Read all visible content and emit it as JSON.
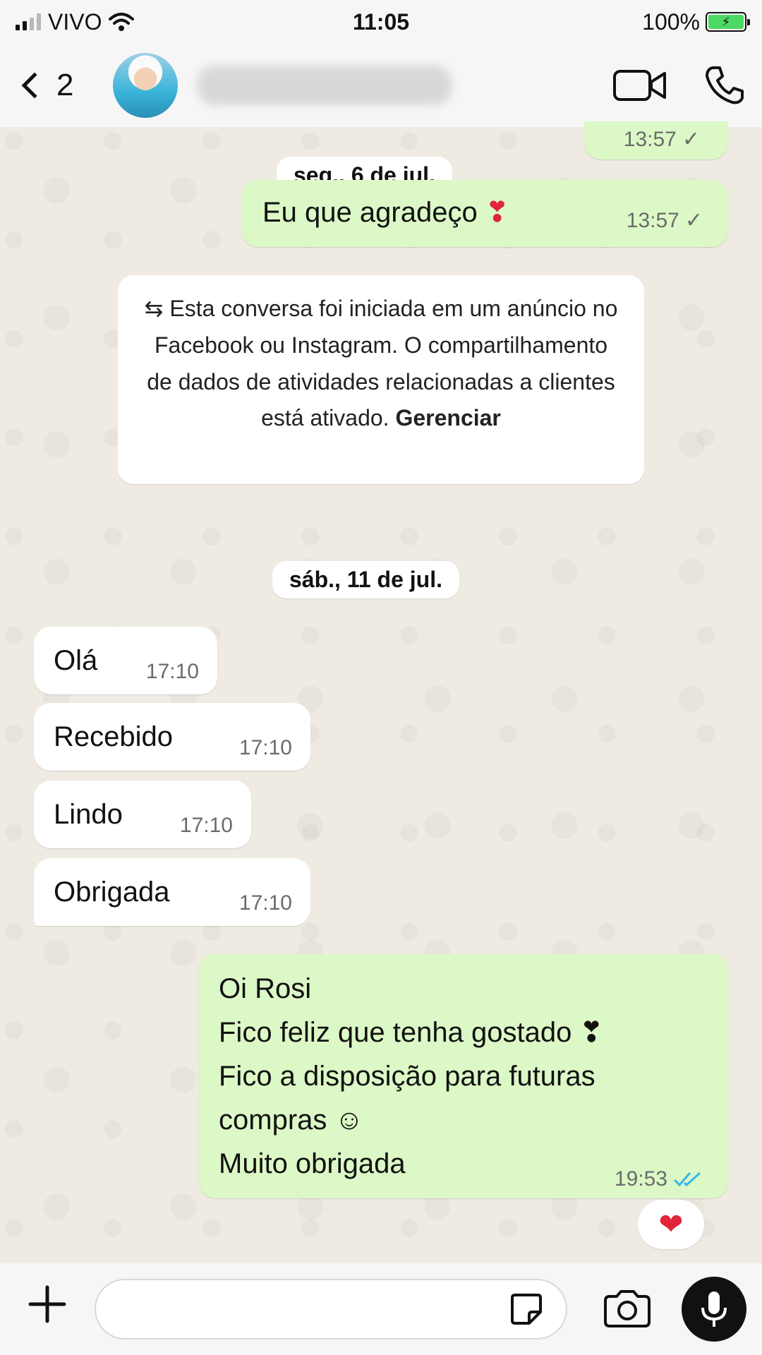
{
  "status_bar": {
    "carrier": "VIVO",
    "time": "11:05",
    "battery": "100%"
  },
  "header": {
    "back_count": "2"
  },
  "messages": {
    "prev_time": "13:57",
    "date1": "seg., 6 de jul.",
    "out1_text": "Eu que agradeço",
    "out1_emoji": "❣",
    "out1_time": "13:57",
    "system_note_text": "⇆ Esta conversa foi iniciada em um anúncio no Facebook ou Instagram. O compartilhamento de dados de atividades relacionadas a clientes está ativado.",
    "system_note_link": "Gerenciar",
    "date2": "sáb., 11 de jul.",
    "in1_text": "Olá",
    "in1_time": "17:10",
    "in2_text": "Recebido",
    "in2_time": "17:10",
    "in3_text": "Lindo",
    "in3_time": "17:10",
    "in4_text": "Obrigada",
    "in4_time": "17:10",
    "out2_lines": [
      "Oi Rosi",
      "Fico feliz que tenha gostado ❣",
      "Fico a disposição para futuras",
      "compras ☺",
      "Muito obrigada"
    ],
    "out2_time": "19:53",
    "reaction": "❤"
  },
  "icons": {
    "signal": "signal-icon",
    "wifi": "wifi-icon",
    "battery": "battery-icon",
    "back": "chevron-left-icon",
    "video": "video-camera-icon",
    "phone": "phone-icon",
    "plus": "plus-icon",
    "sticker": "sticker-icon",
    "camera": "camera-icon",
    "mic": "microphone-icon",
    "single_check": "single-check-icon",
    "double_check": "double-check-icon"
  },
  "colors": {
    "outgoing_bubble": "#dcf8c6",
    "incoming_bubble": "#ffffff",
    "read_ticks": "#34b7f1",
    "background": "#efeae2"
  }
}
